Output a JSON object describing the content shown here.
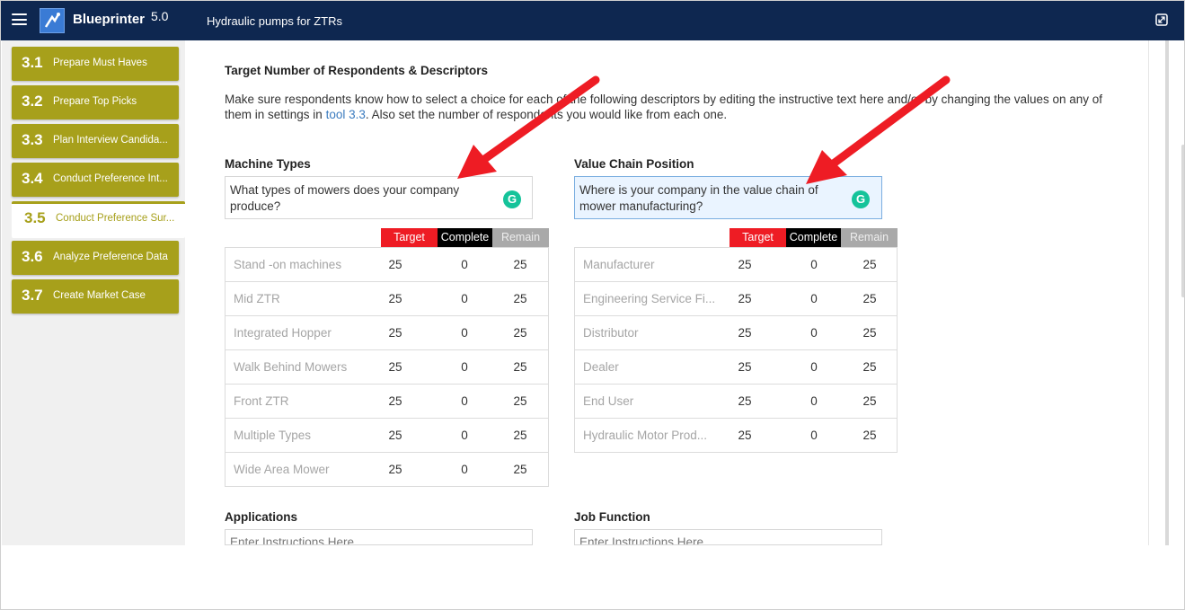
{
  "header": {
    "brand": "Blueprinter",
    "version": "5.0",
    "project_title": "Hydraulic pumps for ZTRs",
    "menu_icon": "hamburger-menu-icon",
    "expand_icon": "expand-icon"
  },
  "sidebar": {
    "items": [
      {
        "num": "3.1",
        "label": "Prepare Must Haves"
      },
      {
        "num": "3.2",
        "label": "Prepare Top Picks"
      },
      {
        "num": "3.3",
        "label": "Plan Interview Candida..."
      },
      {
        "num": "3.4",
        "label": "Conduct Preference Int..."
      },
      {
        "num": "3.5",
        "label": "Conduct Preference Sur..."
      },
      {
        "num": "3.6",
        "label": "Analyze Preference Data"
      },
      {
        "num": "3.7",
        "label": "Create Market Case"
      }
    ],
    "active_index": 4
  },
  "main": {
    "section_title": "Target Number of Respondents & Descriptors",
    "desc_part1": "Make sure respondents know how to select a choice for each of the following descriptors by editing the instructive text here and/or by changing the values on any of them in settings in ",
    "desc_link": "tool 3.3",
    "desc_part2": ". Also set the number of respondents you would like from each one.",
    "columns": {
      "target": "Target",
      "complete": "Complete",
      "remain": "Remain"
    },
    "groups": [
      {
        "label": "Machine Types",
        "instruction": "What types of mowers does your company produce?",
        "rows": [
          {
            "name": "Stand -on machines",
            "target": "25",
            "complete": "0",
            "remain": "25"
          },
          {
            "name": "Mid ZTR",
            "target": "25",
            "complete": "0",
            "remain": "25"
          },
          {
            "name": "Integrated Hopper",
            "target": "25",
            "complete": "0",
            "remain": "25"
          },
          {
            "name": "Walk Behind Mowers",
            "target": "25",
            "complete": "0",
            "remain": "25"
          },
          {
            "name": "Front ZTR",
            "target": "25",
            "complete": "0",
            "remain": "25"
          },
          {
            "name": "Multiple Types",
            "target": "25",
            "complete": "0",
            "remain": "25"
          },
          {
            "name": "Wide Area Mower",
            "target": "25",
            "complete": "0",
            "remain": "25"
          }
        ]
      },
      {
        "label": "Value Chain Position",
        "instruction": "Where is your company in the value chain of mower manufacturing?",
        "rows": [
          {
            "name": "Manufacturer",
            "target": "25",
            "complete": "0",
            "remain": "25"
          },
          {
            "name": "Engineering Service Fi...",
            "target": "25",
            "complete": "0",
            "remain": "25"
          },
          {
            "name": "Distributor",
            "target": "25",
            "complete": "0",
            "remain": "25"
          },
          {
            "name": "Dealer",
            "target": "25",
            "complete": "0",
            "remain": "25"
          },
          {
            "name": "End User",
            "target": "25",
            "complete": "0",
            "remain": "25"
          },
          {
            "name": "Hydraulic Motor Prod...",
            "target": "25",
            "complete": "0",
            "remain": "25"
          }
        ]
      }
    ],
    "more_groups": [
      {
        "label": "Applications",
        "placeholder": "Enter Instructions Here..."
      },
      {
        "label": "Job Function",
        "placeholder": "Enter Instructions Here..."
      }
    ]
  },
  "colors": {
    "topbar": "#0e2750",
    "sidebar_item": "#a7a01b",
    "target_header": "#ee1c24",
    "complete_header": "#000000",
    "remain_header": "#a9a9a9",
    "annotation_arrow": "#ee1c24"
  }
}
